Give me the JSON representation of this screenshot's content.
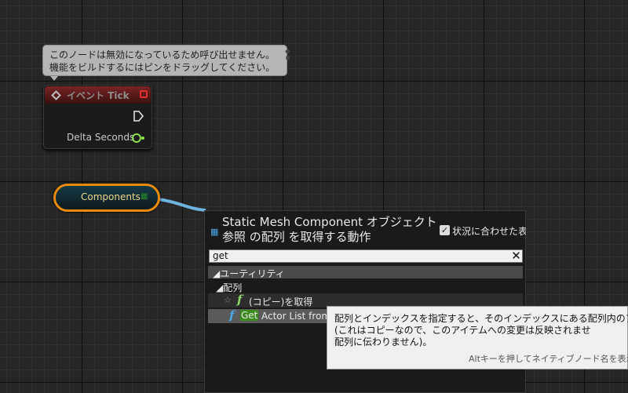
{
  "comment": {
    "line1": "このノードは無効になっているため呼び出せません。",
    "line2": "機能をビルドするにはピンをドラッグしてください。"
  },
  "event_node": {
    "title": "イベント Tick",
    "output_label": "Delta Seconds"
  },
  "components_node": {
    "label": "Components"
  },
  "action_menu": {
    "title": "Static Mesh Component オブジェクト参照 の配列 を取得する動作",
    "context_sensitive_label": "状況に合わせた表",
    "context_sensitive_checked": "✓",
    "search_value": "get",
    "clear_glyph": "✕",
    "categories": [
      {
        "label": "◢ユーティリティ"
      },
      {
        "label": "◢配列"
      }
    ],
    "items": [
      {
        "label": "(コピー)を取得"
      },
      {
        "highlight": "Get",
        "label": "Actor List from"
      }
    ]
  },
  "tooltip": {
    "line1": "配列とインデックスを指定すると、そのインデックスにある配列内のアイテ",
    "line2": "(これはコピーなので、このアイテムへの変更は反映されませ",
    "line3": "配列に伝わりません)。",
    "hint": "Altキーを押してネイティブノード名を表示"
  },
  "colors": {
    "event_header": "#7a2424",
    "component_border": "#e88a10",
    "float_pin": "#8ee048",
    "function_icon": "#4aa8e8",
    "search_highlight": "#3c8c1e"
  }
}
